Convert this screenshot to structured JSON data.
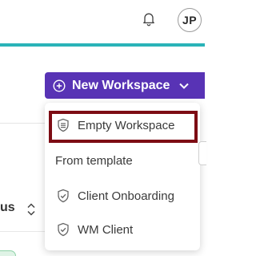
{
  "header": {
    "avatar_initials": "JP",
    "bell_icon": "bell-icon"
  },
  "toolbar": {
    "new_workspace_label": "New Workspace",
    "accent_color": "#5833b5"
  },
  "menu": {
    "items": [
      {
        "label": "Empty Workspace",
        "icon": "layers-shield-icon"
      },
      {
        "label": "From template"
      },
      {
        "label": "Client Onboarding",
        "icon": "shield-check-icon"
      },
      {
        "label": "WM Client",
        "icon": "shield-check-icon"
      }
    ]
  },
  "table": {
    "status_header_partial": "us"
  },
  "colors": {
    "accent_line": "#2ab3b8",
    "highlight_border": "#7d0c14"
  }
}
